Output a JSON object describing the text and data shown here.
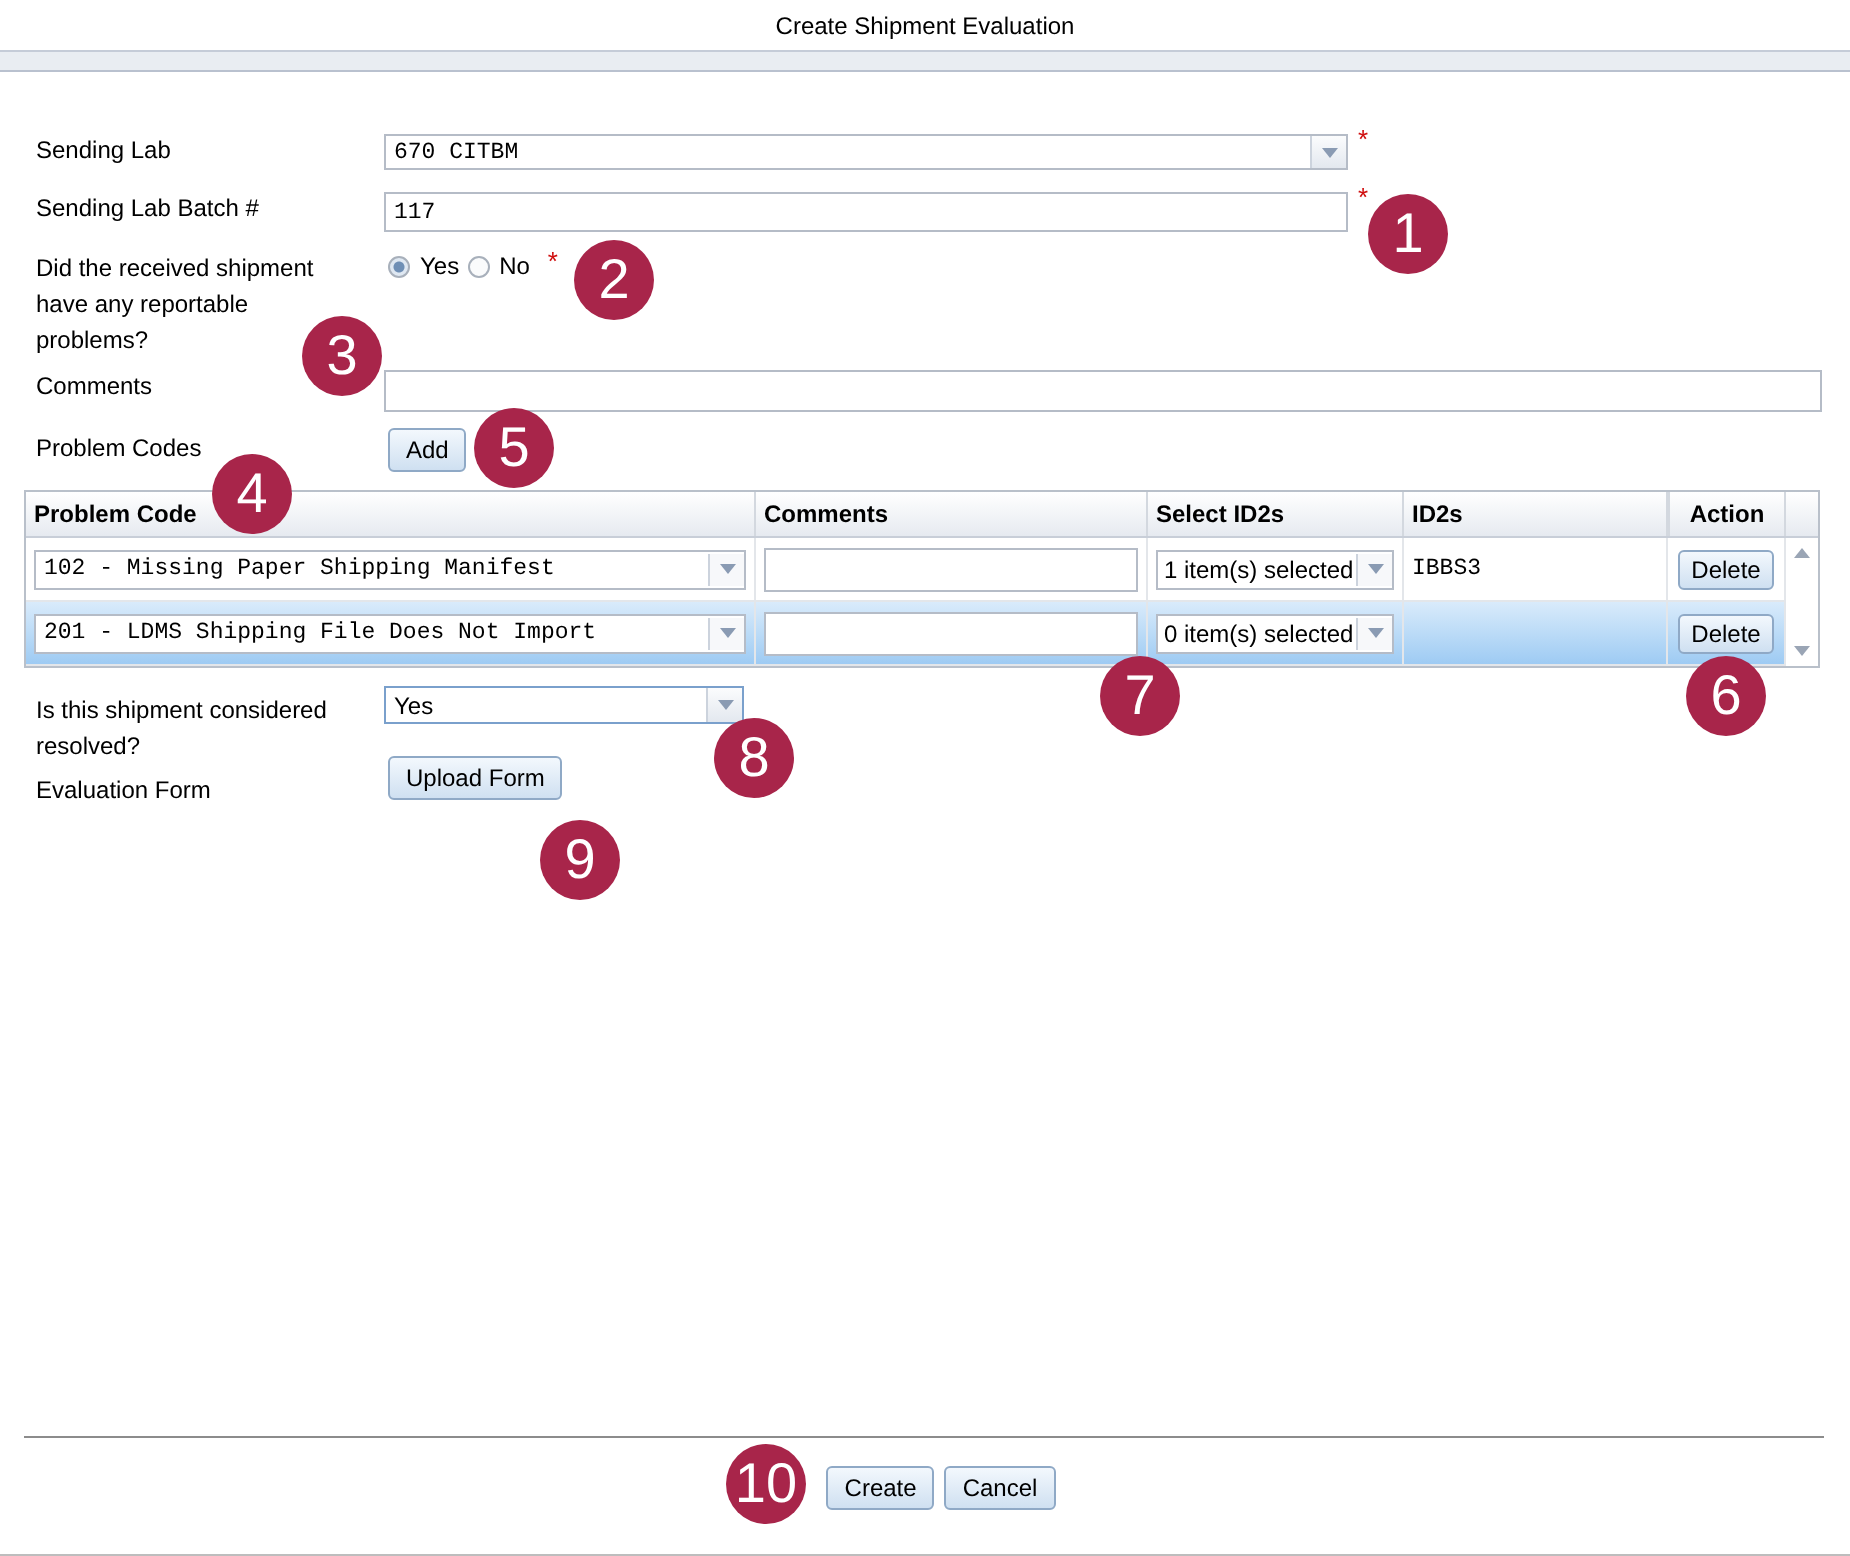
{
  "window": {
    "title": "Create Shipment Evaluation"
  },
  "form": {
    "sending_lab": {
      "label": "Sending Lab",
      "value": "670 CITBM",
      "required_mark": "*"
    },
    "batch": {
      "label": "Sending Lab Batch #",
      "value": "117",
      "required_mark": "*"
    },
    "problems_question": {
      "label": "Did the received shipment have any reportable problems?",
      "required_mark": "*",
      "options": [
        {
          "label": "Yes",
          "selected": true
        },
        {
          "label": "No",
          "selected": false
        }
      ]
    },
    "comments": {
      "label": "Comments"
    },
    "problem_codes": {
      "label": "Problem Codes",
      "button": "Add"
    },
    "grid": {
      "columns": [
        "Problem Code",
        "Comments",
        "Select ID2s",
        "ID2s",
        "Action"
      ],
      "rows": [
        {
          "problem_code": "102 - Missing Paper Shipping Manifest",
          "id2s_select": "1 item(s) selected",
          "id2s": "IBBS3",
          "action": "Delete",
          "selected": false
        },
        {
          "problem_code": "201 - LDMS Shipping File Does Not Import",
          "id2s_select": "0 item(s) selected",
          "action": "Delete",
          "selected": true
        }
      ]
    },
    "resolved": {
      "label": "Is this shipment considered resolved?",
      "value": "Yes"
    },
    "evaluation_form": {
      "label": "Evaluation Form",
      "button": "Upload Form"
    }
  },
  "buttons": [
    "Create",
    "Cancel"
  ],
  "callouts": [
    "1",
    "2",
    "3",
    "4",
    "5",
    "6",
    "7",
    "8",
    "9",
    "10"
  ]
}
